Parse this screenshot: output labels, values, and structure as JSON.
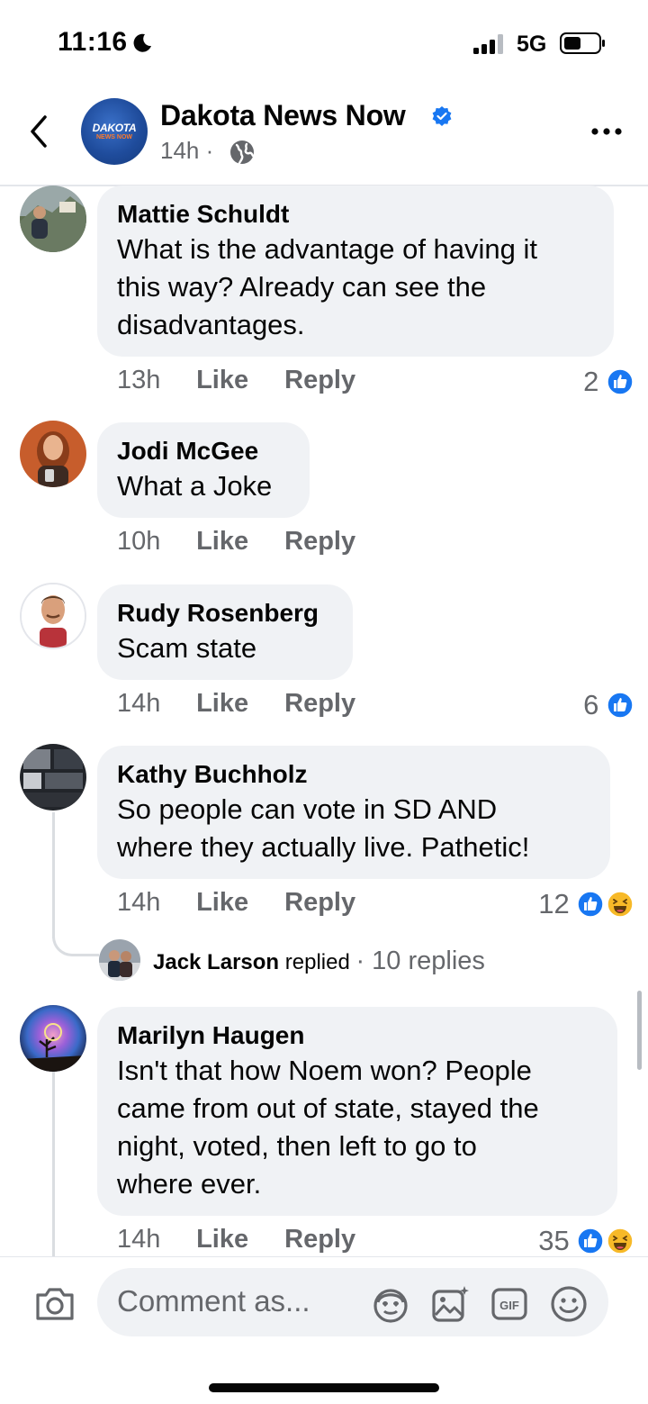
{
  "status_bar": {
    "time": "11:16",
    "network": "5G"
  },
  "header": {
    "logo_text": "DAKOTA",
    "logo_sub": "NEWS NOW",
    "page_name": "Dakota News Now",
    "post_time": "14h",
    "separator": "·"
  },
  "comments": [
    {
      "author": "Mattie Schuldt",
      "lines": [
        "What is the advantage of having it",
        "this way? Already can see the",
        "disadvantages."
      ],
      "time": "13h",
      "like_label": "Like",
      "reply_label": "Reply",
      "reactions": "2"
    },
    {
      "author": "Jodi McGee",
      "lines": [
        "What a Joke"
      ],
      "time": "10h",
      "like_label": "Like",
      "reply_label": "Reply",
      "reactions": ""
    },
    {
      "author": "Rudy Rosenberg",
      "lines": [
        "Scam state"
      ],
      "time": "14h",
      "like_label": "Like",
      "reply_label": "Reply",
      "reactions": "6"
    },
    {
      "author": "Kathy Buchholz",
      "lines": [
        "So people can vote in SD AND",
        "where they actually live.  Pathetic!"
      ],
      "time": "14h",
      "like_label": "Like",
      "reply_label": "Reply",
      "reactions": "12"
    },
    {
      "author": "Marilyn Haugen",
      "lines": [
        "Isn't that how Noem won? People",
        "came from out of state, stayed the",
        "night, voted, then left to go to",
        "where ever."
      ],
      "time": "14h",
      "like_label": "Like",
      "reply_label": "Reply",
      "reactions": "35"
    }
  ],
  "replies_preview": {
    "name": "Jack Larson",
    "verb": "replied",
    "count": "· 10 replies"
  },
  "composer": {
    "placeholder": "Comment as..."
  },
  "icons": {
    "back": "chevron-left-icon",
    "verified": "verified-badge-icon",
    "globe": "globe-icon",
    "more": "more-icon",
    "like_reaction": "like-reaction-icon",
    "haha_reaction": "haha-reaction-icon",
    "camera": "camera-icon",
    "avatar_sticker": "avatar-sticker-icon",
    "photo": "photo-icon",
    "gif": "gif-icon",
    "emoji": "emoji-icon"
  },
  "colors": {
    "accent": "#1877f2",
    "text_secondary": "#65676b",
    "bubble": "#f0f2f5",
    "haha": "#f7b928"
  }
}
